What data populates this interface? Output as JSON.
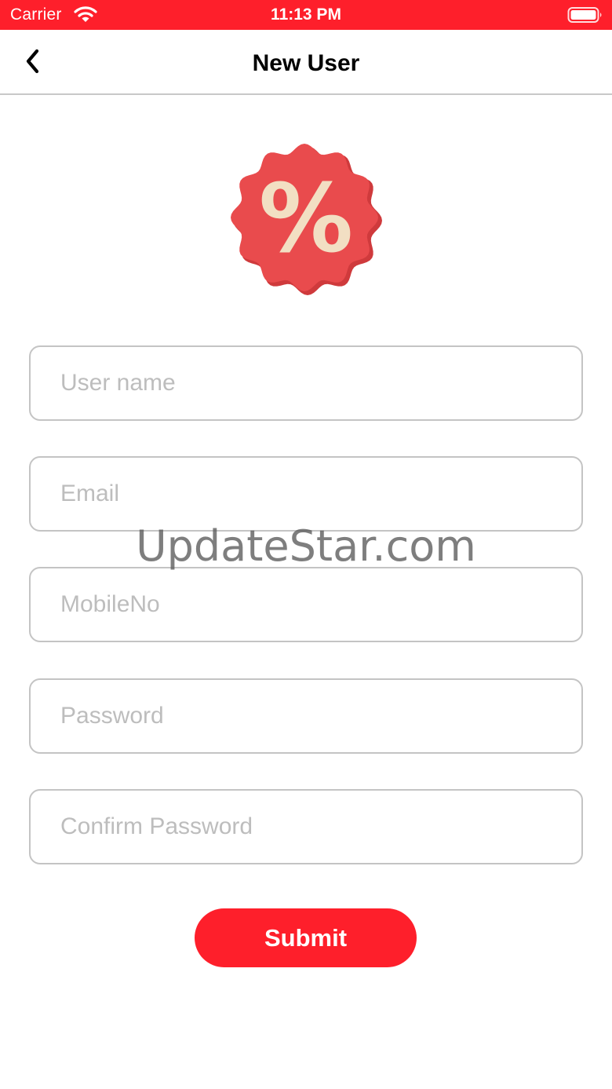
{
  "status_bar": {
    "carrier": "Carrier",
    "time": "11:13 PM",
    "wifi_icon": "wifi-icon",
    "battery_icon": "battery-icon",
    "background_color": "#fe1f2b"
  },
  "nav": {
    "back_icon": "chevron-left-icon",
    "title": "New User"
  },
  "logo": {
    "icon": "percent-badge-icon",
    "badge_color": "#e94b4d",
    "symbol_color": "#f2dfc3",
    "symbol": "%"
  },
  "form": {
    "username": {
      "value": "",
      "placeholder": "User name"
    },
    "email": {
      "value": "",
      "placeholder": "Email"
    },
    "mobile": {
      "value": "",
      "placeholder": "MobileNo"
    },
    "password": {
      "value": "",
      "placeholder": "Password"
    },
    "confirm_password": {
      "value": "",
      "placeholder": "Confirm Password"
    }
  },
  "submit_label": "Submit",
  "accent_color": "#fe1f2b",
  "watermark": "UpdateStar.com"
}
